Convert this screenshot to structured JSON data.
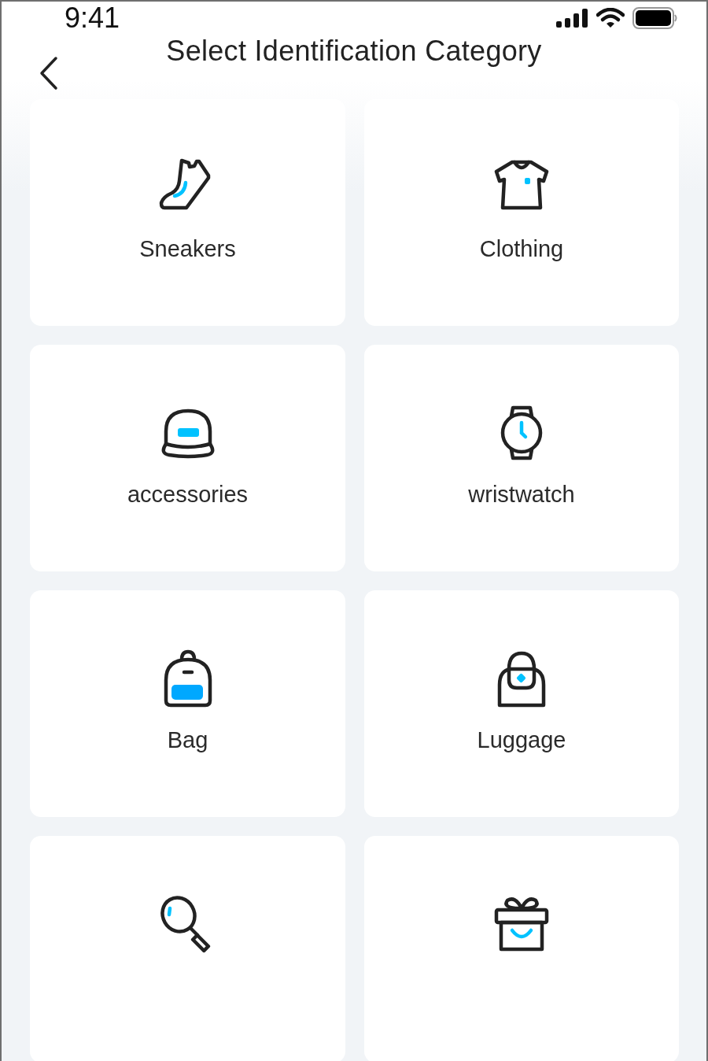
{
  "status_bar": {
    "time": "9:41"
  },
  "header": {
    "title": "Select Identification Category"
  },
  "categories": [
    {
      "kind": "sneaker",
      "label": "Sneakers"
    },
    {
      "kind": "shirt",
      "label": "Clothing"
    },
    {
      "kind": "cap",
      "label": "accessories"
    },
    {
      "kind": "watch",
      "label": "wristwatch"
    },
    {
      "kind": "backpack",
      "label": "Bag"
    },
    {
      "kind": "handbag",
      "label": "Luggage"
    },
    {
      "kind": "magnifier"
    },
    {
      "kind": "gift"
    }
  ]
}
